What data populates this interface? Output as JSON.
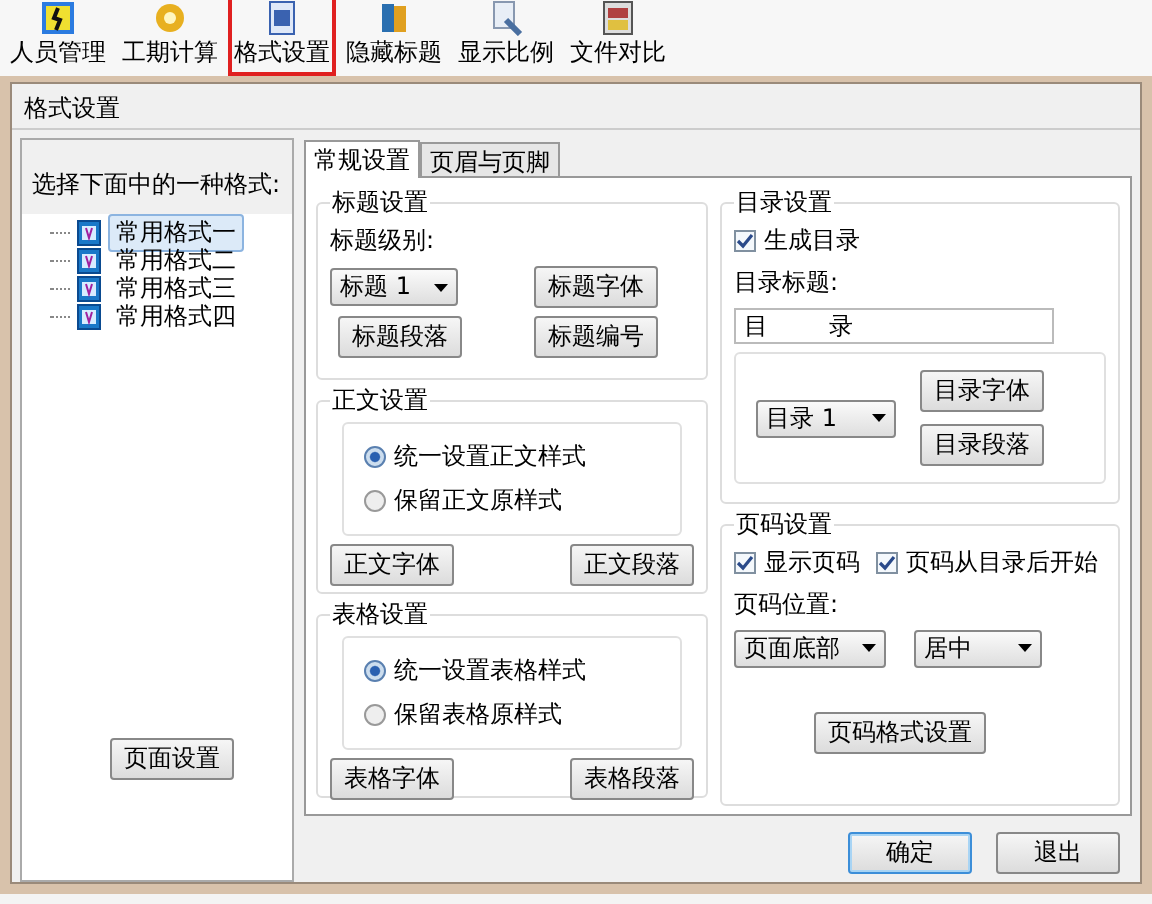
{
  "toolbar": [
    {
      "label": "人员管理",
      "selected": false
    },
    {
      "label": "工期计算",
      "selected": false
    },
    {
      "label": "格式设置",
      "selected": true
    },
    {
      "label": "隐藏标题",
      "selected": false
    },
    {
      "label": "显示比例",
      "selected": false
    },
    {
      "label": "文件对比",
      "selected": false
    }
  ],
  "dialog": {
    "title": "格式设置",
    "format_panel": {
      "prompt": "选择下面中的一种格式:",
      "items": [
        {
          "label": "常用格式一",
          "selected": true
        },
        {
          "label": "常用格式二",
          "selected": false
        },
        {
          "label": "常用格式三",
          "selected": false
        },
        {
          "label": "常用格式四",
          "selected": false
        }
      ],
      "button": "页面设置"
    },
    "tabs": [
      {
        "label": "常规设置",
        "selected": true
      },
      {
        "label": "页眉与页脚",
        "selected": false
      }
    ],
    "heading_settings": {
      "title": "标题设置",
      "level_label": "标题级别:",
      "level_value": "标题 1",
      "buttons": [
        "标题字体",
        "标题段落",
        "标题编号"
      ]
    },
    "body_settings": {
      "title": "正文设置",
      "options": [
        {
          "label": "统一设置正文样式",
          "selected": true
        },
        {
          "label": "保留正文原样式",
          "selected": false
        }
      ],
      "buttons": [
        "正文字体",
        "正文段落"
      ]
    },
    "table_settings": {
      "title": "表格设置",
      "options": [
        {
          "label": "统一设置表格样式",
          "selected": true
        },
        {
          "label": "保留表格原样式",
          "selected": false
        }
      ],
      "buttons": [
        "表格字体",
        "表格段落"
      ]
    },
    "toc_settings": {
      "title": "目录设置",
      "generate": {
        "label": "生成目录",
        "checked": true
      },
      "title_label": "目录标题:",
      "title_value": "目        录",
      "level_value": "目录 1",
      "buttons": [
        "目录字体",
        "目录段落"
      ]
    },
    "page_number_settings": {
      "title": "页码设置",
      "options": [
        {
          "label": "显示页码",
          "checked": true
        },
        {
          "label": "页码从目录后开始",
          "checked": true
        }
      ],
      "position_label": "页码位置:",
      "position_value": "页面底部",
      "align_value": "居中",
      "button": "页码格式设置"
    },
    "footer_buttons": [
      {
        "label": "确定",
        "default": true
      },
      {
        "label": "退出",
        "default": false
      }
    ]
  }
}
